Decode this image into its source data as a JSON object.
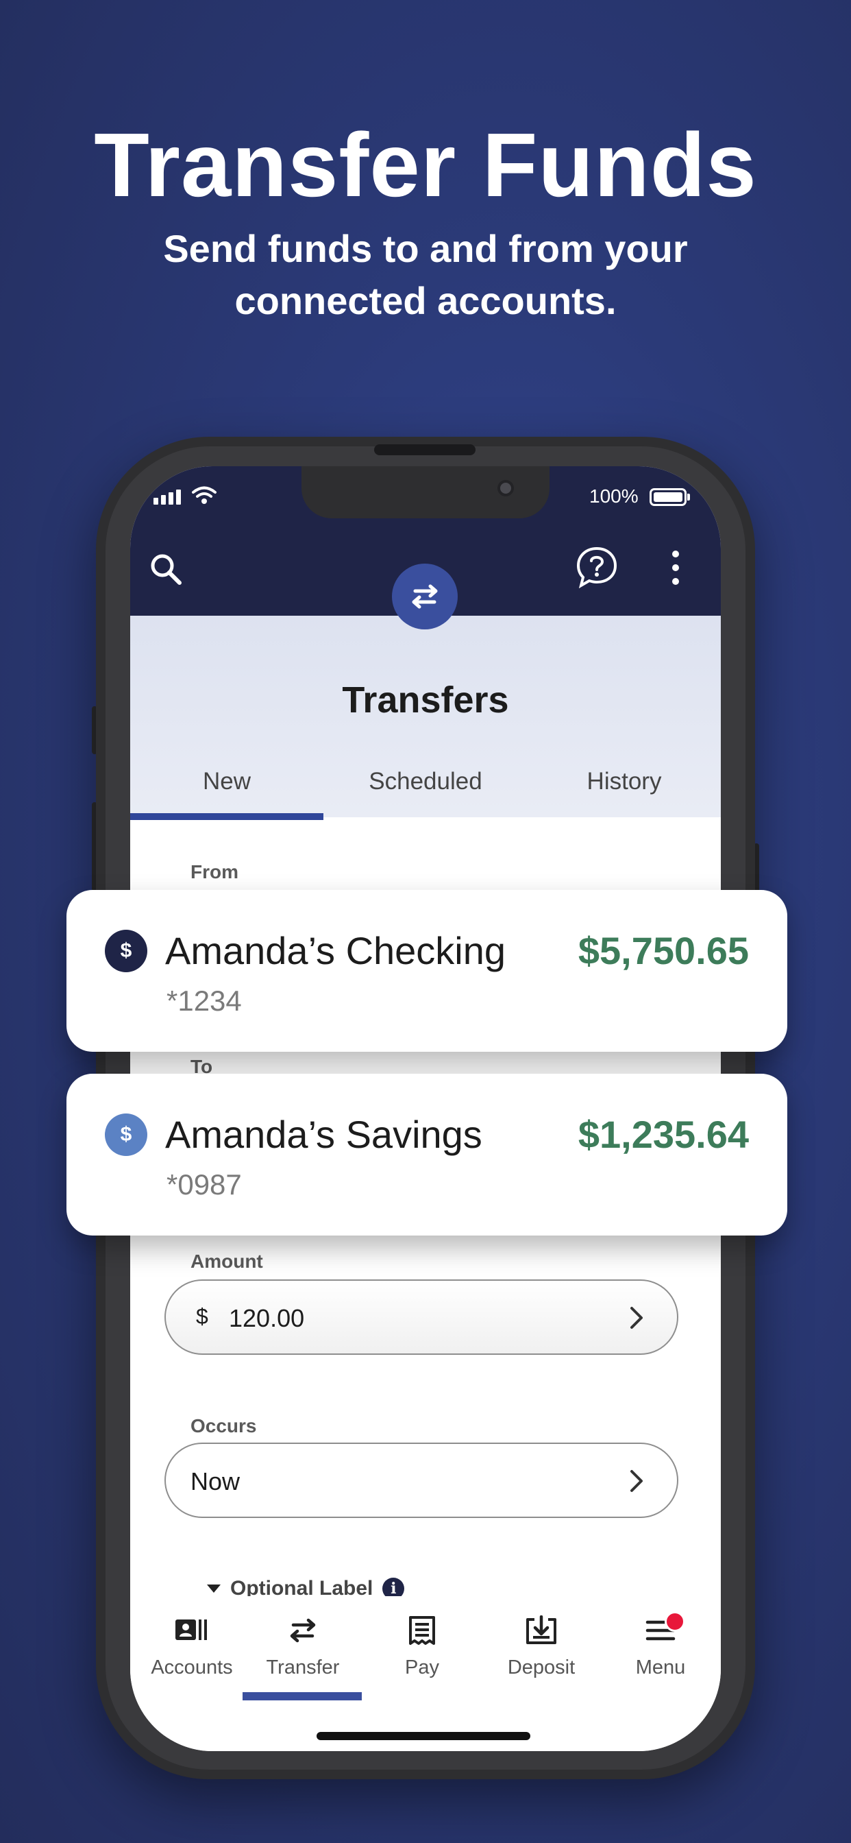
{
  "hero": {
    "title": "Transfer Funds",
    "subtitle": "Send funds to and from your connected accounts."
  },
  "status_bar": {
    "battery_percent": "100%"
  },
  "app_header": {
    "icons": [
      "search-icon",
      "help-chat-icon",
      "more-vertical-icon"
    ],
    "center_icon": "transfer-arrows-icon"
  },
  "page": {
    "title": "Transfers",
    "tabs": [
      {
        "label": "New",
        "active": true
      },
      {
        "label": "Scheduled",
        "active": false
      },
      {
        "label": "History",
        "active": false
      }
    ]
  },
  "form": {
    "from_label": "From",
    "to_label": "To",
    "amount_label": "Amount",
    "currency_symbol": "$",
    "amount_value": "120.00",
    "occurs_label": "Occurs",
    "occurs_value": "Now",
    "optional_label": "Optional Label"
  },
  "accounts": {
    "from": {
      "name": "Amanda’s Checking",
      "number": "*1234",
      "balance": "$5,750.65",
      "icon_color": "#1f2447"
    },
    "to": {
      "name": "Amanda’s Savings",
      "number": "*0987",
      "balance": "$1,235.64",
      "icon_color": "#5b82c4"
    }
  },
  "bottom_nav": {
    "items": [
      {
        "label": "Accounts",
        "icon": "accounts-icon"
      },
      {
        "label": "Transfer",
        "icon": "transfer-icon",
        "active": true
      },
      {
        "label": "Pay",
        "icon": "receipt-icon"
      },
      {
        "label": "Deposit",
        "icon": "deposit-icon"
      },
      {
        "label": "Menu",
        "icon": "menu-icon",
        "badge": true
      }
    ]
  },
  "colors": {
    "brand_navy": "#1f2447",
    "accent_blue": "#3a4f9e",
    "balance_green": "#3d7c5a",
    "notification_red": "#e8173a"
  }
}
